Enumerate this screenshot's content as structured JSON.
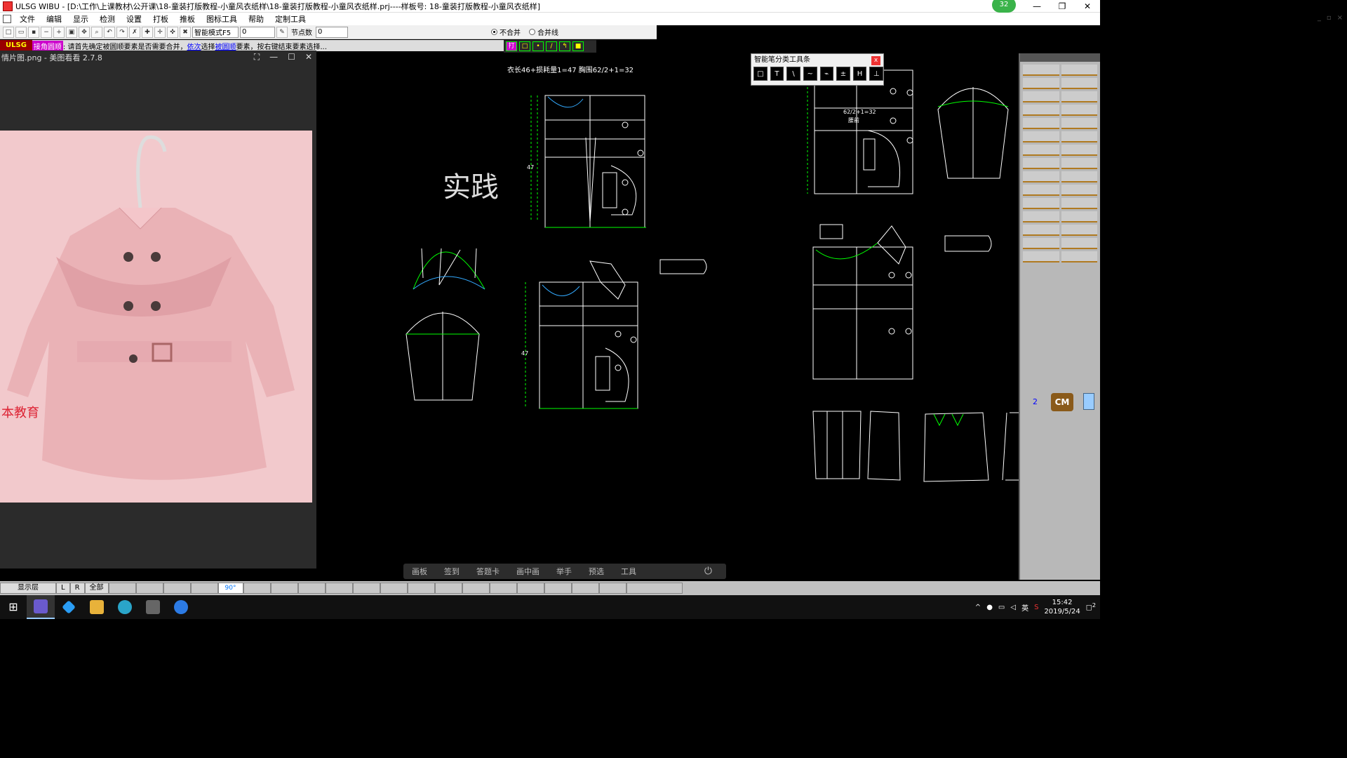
{
  "titlebar": {
    "title": "ULSG WIBU - [D:\\工作\\上课教材\\公开课\\18-童装打版教程-小童风衣纸样\\18-童装打版教程-小童风衣纸样.prj----样板号: 18-童装打版教程-小童风衣纸样]",
    "badge": "32",
    "min": "—",
    "max": "❐",
    "close": "✕"
  },
  "menu": [
    "文件",
    "编辑",
    "显示",
    "检测",
    "设置",
    "打板",
    "推板",
    "图标工具",
    "帮助",
    "定制工具"
  ],
  "toolbar": {
    "mode_select": "智能模式F5",
    "value_input": "0",
    "node_label": "节点数",
    "node_value": "0",
    "radio_nomerge": "不合并",
    "radio_mergeline": "合并线"
  },
  "hint": {
    "brand": "ULSG",
    "prefix": "接角圆顺",
    "text1": ": 请首先确定被圆顺要素是否需要合并，",
    "link1": "依次",
    "text2": "选择",
    "link2": "被圆顺",
    "text3": "要素，按右键结束要素选择..."
  },
  "viewer": {
    "title": "情片图.png - 美图看看 2.7.8",
    "watermark": "本教育"
  },
  "canvas": {
    "annotation": "衣长46+损耗量1=47  胸围62/2+1=32",
    "handwriting": "实践",
    "dash": "一",
    "label_chest": "62/2+1=32",
    "label_front": "腰前"
  },
  "toolpanel": {
    "title": "智能笔分类工具条",
    "close": "x",
    "tools": [
      "□",
      "T",
      "\\",
      "~",
      "⌁",
      "±",
      "H",
      "⊥"
    ]
  },
  "rightpanel": {
    "cm": "CM",
    "num": "2"
  },
  "bottommenu": [
    "画板",
    "签到",
    "答题卡",
    "画中画",
    "举手",
    "预选",
    "工具"
  ],
  "statusbar": {
    "layer": "显示层",
    "l": "L",
    "r": "R",
    "all": "全部",
    "deg": "90°"
  },
  "tray": {
    "ime": "英",
    "time": "15:42",
    "date": "2019/5/24",
    "notify": "2"
  },
  "colors": {
    "pattern_line": "#ffffff",
    "construction_green": "#00ff00",
    "photo_bg": "#f2c9cc",
    "coat_pink": "#eab2b6"
  }
}
